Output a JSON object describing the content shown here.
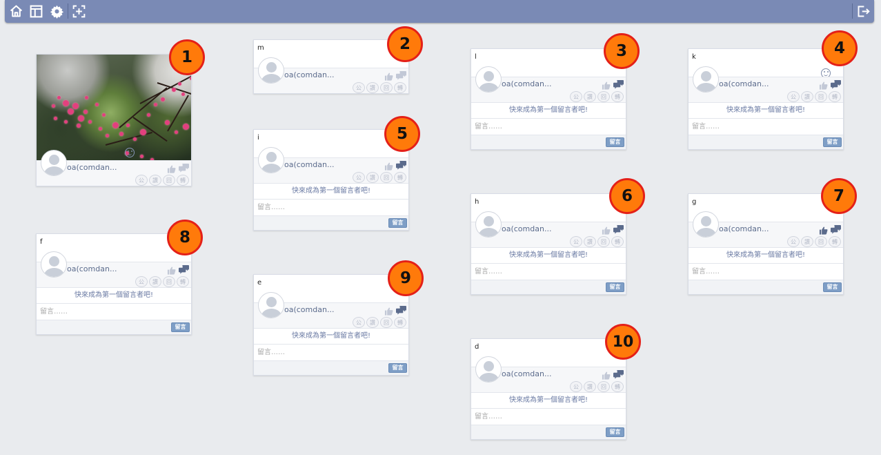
{
  "toolbar": {
    "left_icons": [
      "home-icon",
      "layout-icon",
      "gear-icon",
      "add-frame-icon"
    ],
    "right_icons": [
      "logout-icon"
    ],
    "colors": {
      "bar": "#7a8ab5",
      "icon": "#ffffff"
    }
  },
  "common": {
    "author": "oa(comdan...",
    "first_comment_prompt": "快來成為第一個留言者吧!",
    "comment_placeholder": "留言……",
    "post_button": "留言",
    "action_labels": [
      "公",
      "讚",
      "回",
      "轉"
    ]
  },
  "cards": [
    {
      "id": "photo-card",
      "title": "",
      "has_photo": true,
      "liked": false
    },
    {
      "id": "m",
      "title": "m",
      "has_photo": false,
      "has_comments": false,
      "liked": false
    },
    {
      "id": "l",
      "title": "l",
      "has_photo": false,
      "has_comments": true,
      "liked": false
    },
    {
      "id": "k",
      "title": "k",
      "has_photo": false,
      "has_comments": true,
      "liked": false,
      "smiley": true
    },
    {
      "id": "i",
      "title": "i",
      "has_photo": false,
      "has_comments": true,
      "liked": false
    },
    {
      "id": "h",
      "title": "h",
      "has_photo": false,
      "has_comments": true,
      "liked": false
    },
    {
      "id": "g",
      "title": "g",
      "has_photo": false,
      "has_comments": true,
      "liked": true
    },
    {
      "id": "f",
      "title": "f",
      "has_photo": false,
      "has_comments": true,
      "liked": false
    },
    {
      "id": "e",
      "title": "e",
      "has_photo": false,
      "has_comments": true,
      "liked": false
    },
    {
      "id": "d",
      "title": "d",
      "has_photo": false,
      "has_comments": true,
      "liked": false
    }
  ],
  "badges": [
    "1",
    "2",
    "3",
    "4",
    "5",
    "6",
    "7",
    "8",
    "9",
    "10"
  ],
  "colors": {
    "background": "#e9ebee",
    "badge_fill": "#ff7a0a",
    "badge_ring": "#e42018",
    "post_button": "#7e9ec6",
    "icon_muted": "#c2c8d6",
    "icon_active": "#5b6b8c"
  }
}
